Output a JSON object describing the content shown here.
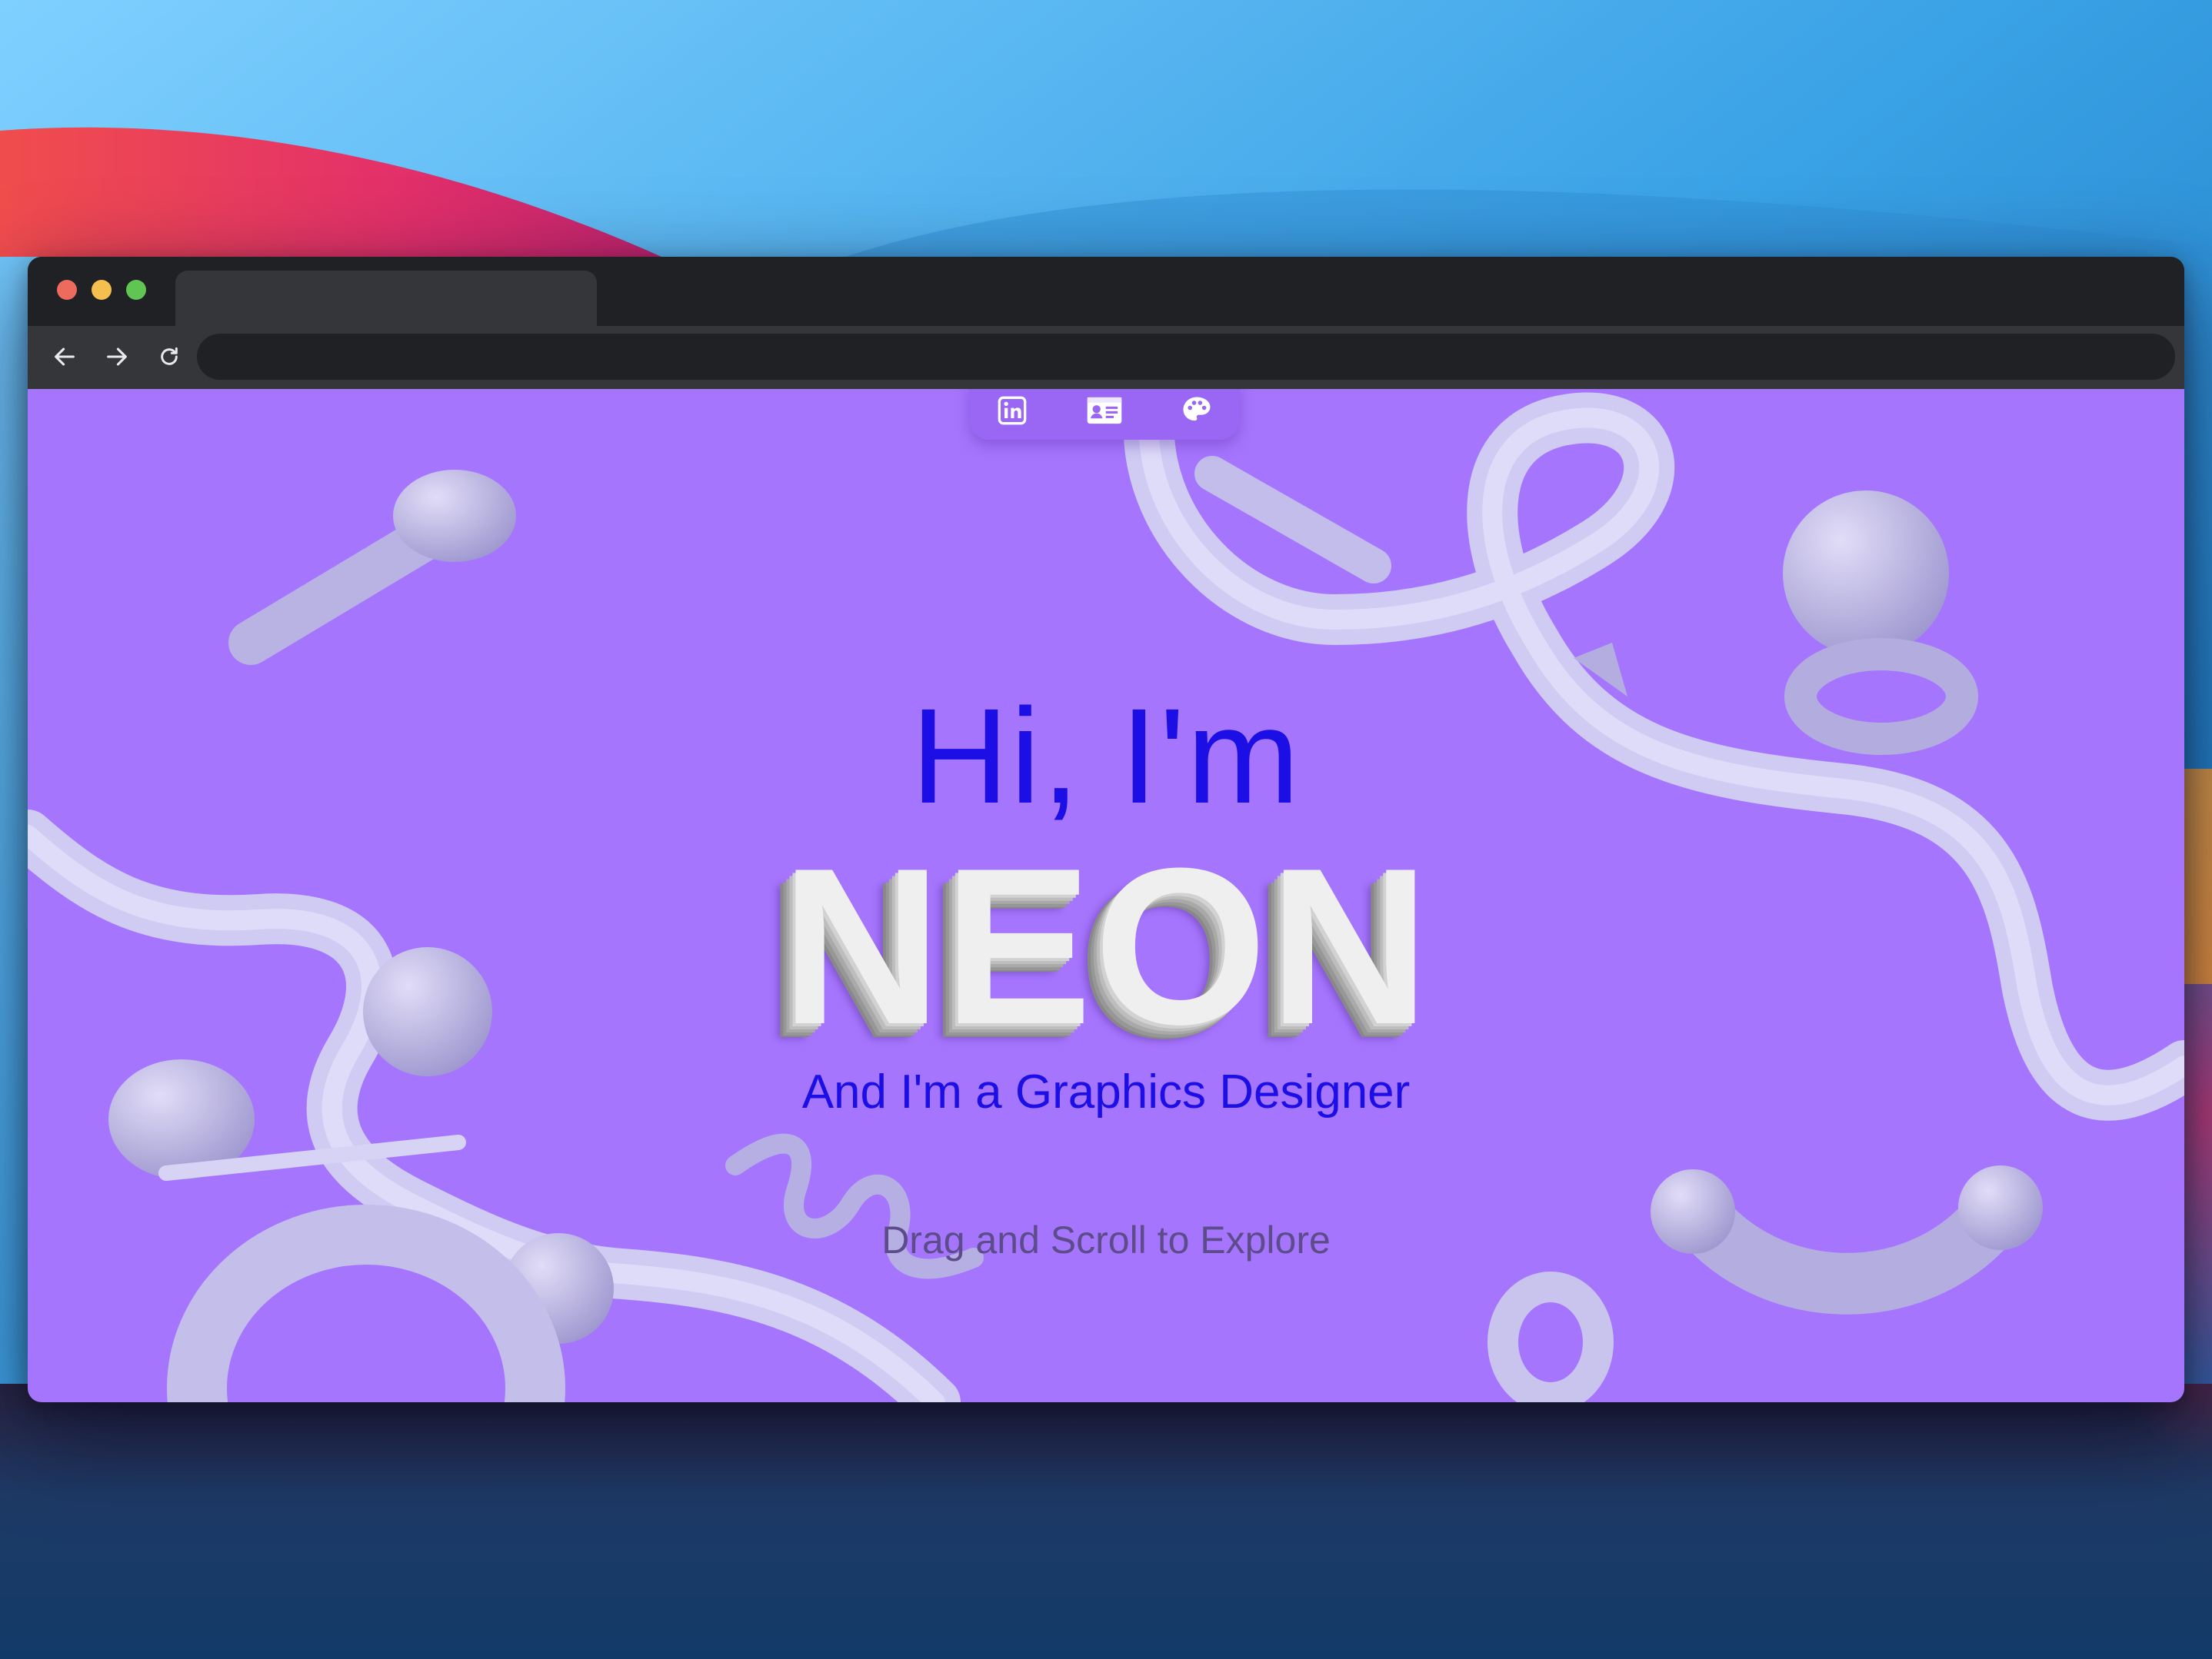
{
  "colors": {
    "page_background": "#a675fe",
    "accent_text": "#1b0fe6",
    "hint_text": "#5d4c8a",
    "name_text": "#efefef",
    "shape_color": "#d6d3f5",
    "browser_chrome": "#202124",
    "toolbar": "#35363a"
  },
  "window_controls": {
    "close": {
      "icon": "close-dot",
      "color": "#ed6a5e"
    },
    "minimize": {
      "icon": "minimize-dot",
      "color": "#f5bf4f"
    },
    "zoom": {
      "icon": "zoom-dot",
      "color": "#61c554"
    }
  },
  "navigation": {
    "back_icon": "arrow-left-icon",
    "forward_icon": "arrow-right-icon",
    "reload_icon": "reload-icon",
    "address": ""
  },
  "social_bar": {
    "items": [
      {
        "icon": "linkedin-icon"
      },
      {
        "icon": "contact-card-icon"
      },
      {
        "icon": "palette-icon"
      }
    ]
  },
  "hero": {
    "greeting": "Hi, I'm",
    "name": "NEON",
    "subtitle": "And I'm a Graphics Designer",
    "hint": "Drag and Scroll to Explore"
  }
}
